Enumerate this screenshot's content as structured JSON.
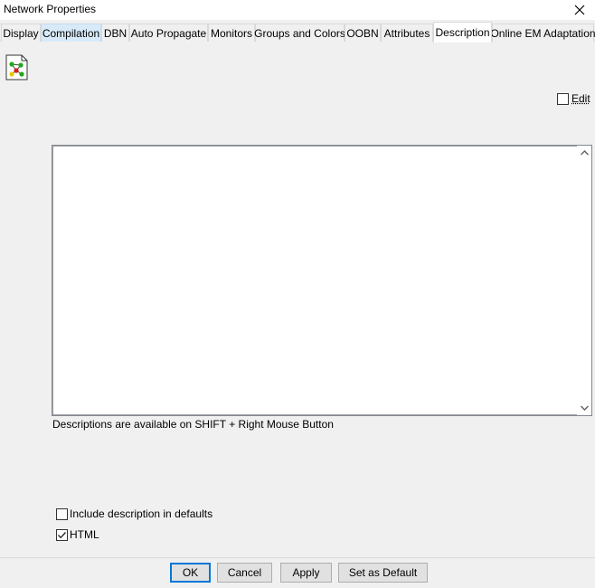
{
  "window": {
    "title": "Network Properties"
  },
  "tabs": [
    {
      "label": "Display"
    },
    {
      "label": "Compilation"
    },
    {
      "label": "DBN"
    },
    {
      "label": "Auto Propagate"
    },
    {
      "label": "Monitors"
    },
    {
      "label": "Groups and Colors"
    },
    {
      "label": "OOBN"
    },
    {
      "label": "Attributes"
    },
    {
      "label": "Description"
    },
    {
      "label": "Online EM Adaptation"
    }
  ],
  "active_tab": "Description",
  "description": {
    "icon": "network-icon",
    "edit_label": "Edit",
    "edit_checked": false,
    "text": "",
    "hint": "Descriptions are available on SHIFT + Right Mouse Button"
  },
  "options": {
    "include_label": "Include description in defaults",
    "include_checked": false,
    "html_label": "HTML",
    "html_checked": true
  },
  "buttons": {
    "ok": "OK",
    "cancel": "Cancel",
    "apply": "Apply",
    "set_default": "Set as Default"
  },
  "colors": {
    "accent": "#0078d7",
    "tab_hover": "#d8eaf9"
  }
}
